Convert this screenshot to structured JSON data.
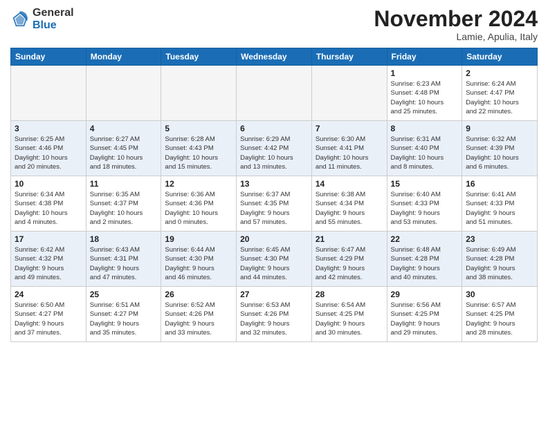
{
  "header": {
    "logo_general": "General",
    "logo_blue": "Blue",
    "month_title": "November 2024",
    "location": "Lamie, Apulia, Italy"
  },
  "columns": [
    "Sunday",
    "Monday",
    "Tuesday",
    "Wednesday",
    "Thursday",
    "Friday",
    "Saturday"
  ],
  "weeks": [
    [
      {
        "day": "",
        "info": ""
      },
      {
        "day": "",
        "info": ""
      },
      {
        "day": "",
        "info": ""
      },
      {
        "day": "",
        "info": ""
      },
      {
        "day": "",
        "info": ""
      },
      {
        "day": "1",
        "info": "Sunrise: 6:23 AM\nSunset: 4:48 PM\nDaylight: 10 hours\nand 25 minutes."
      },
      {
        "day": "2",
        "info": "Sunrise: 6:24 AM\nSunset: 4:47 PM\nDaylight: 10 hours\nand 22 minutes."
      }
    ],
    [
      {
        "day": "3",
        "info": "Sunrise: 6:25 AM\nSunset: 4:46 PM\nDaylight: 10 hours\nand 20 minutes."
      },
      {
        "day": "4",
        "info": "Sunrise: 6:27 AM\nSunset: 4:45 PM\nDaylight: 10 hours\nand 18 minutes."
      },
      {
        "day": "5",
        "info": "Sunrise: 6:28 AM\nSunset: 4:43 PM\nDaylight: 10 hours\nand 15 minutes."
      },
      {
        "day": "6",
        "info": "Sunrise: 6:29 AM\nSunset: 4:42 PM\nDaylight: 10 hours\nand 13 minutes."
      },
      {
        "day": "7",
        "info": "Sunrise: 6:30 AM\nSunset: 4:41 PM\nDaylight: 10 hours\nand 11 minutes."
      },
      {
        "day": "8",
        "info": "Sunrise: 6:31 AM\nSunset: 4:40 PM\nDaylight: 10 hours\nand 8 minutes."
      },
      {
        "day": "9",
        "info": "Sunrise: 6:32 AM\nSunset: 4:39 PM\nDaylight: 10 hours\nand 6 minutes."
      }
    ],
    [
      {
        "day": "10",
        "info": "Sunrise: 6:34 AM\nSunset: 4:38 PM\nDaylight: 10 hours\nand 4 minutes."
      },
      {
        "day": "11",
        "info": "Sunrise: 6:35 AM\nSunset: 4:37 PM\nDaylight: 10 hours\nand 2 minutes."
      },
      {
        "day": "12",
        "info": "Sunrise: 6:36 AM\nSunset: 4:36 PM\nDaylight: 10 hours\nand 0 minutes."
      },
      {
        "day": "13",
        "info": "Sunrise: 6:37 AM\nSunset: 4:35 PM\nDaylight: 9 hours\nand 57 minutes."
      },
      {
        "day": "14",
        "info": "Sunrise: 6:38 AM\nSunset: 4:34 PM\nDaylight: 9 hours\nand 55 minutes."
      },
      {
        "day": "15",
        "info": "Sunrise: 6:40 AM\nSunset: 4:33 PM\nDaylight: 9 hours\nand 53 minutes."
      },
      {
        "day": "16",
        "info": "Sunrise: 6:41 AM\nSunset: 4:33 PM\nDaylight: 9 hours\nand 51 minutes."
      }
    ],
    [
      {
        "day": "17",
        "info": "Sunrise: 6:42 AM\nSunset: 4:32 PM\nDaylight: 9 hours\nand 49 minutes."
      },
      {
        "day": "18",
        "info": "Sunrise: 6:43 AM\nSunset: 4:31 PM\nDaylight: 9 hours\nand 47 minutes."
      },
      {
        "day": "19",
        "info": "Sunrise: 6:44 AM\nSunset: 4:30 PM\nDaylight: 9 hours\nand 46 minutes."
      },
      {
        "day": "20",
        "info": "Sunrise: 6:45 AM\nSunset: 4:30 PM\nDaylight: 9 hours\nand 44 minutes."
      },
      {
        "day": "21",
        "info": "Sunrise: 6:47 AM\nSunset: 4:29 PM\nDaylight: 9 hours\nand 42 minutes."
      },
      {
        "day": "22",
        "info": "Sunrise: 6:48 AM\nSunset: 4:28 PM\nDaylight: 9 hours\nand 40 minutes."
      },
      {
        "day": "23",
        "info": "Sunrise: 6:49 AM\nSunset: 4:28 PM\nDaylight: 9 hours\nand 38 minutes."
      }
    ],
    [
      {
        "day": "24",
        "info": "Sunrise: 6:50 AM\nSunset: 4:27 PM\nDaylight: 9 hours\nand 37 minutes."
      },
      {
        "day": "25",
        "info": "Sunrise: 6:51 AM\nSunset: 4:27 PM\nDaylight: 9 hours\nand 35 minutes."
      },
      {
        "day": "26",
        "info": "Sunrise: 6:52 AM\nSunset: 4:26 PM\nDaylight: 9 hours\nand 33 minutes."
      },
      {
        "day": "27",
        "info": "Sunrise: 6:53 AM\nSunset: 4:26 PM\nDaylight: 9 hours\nand 32 minutes."
      },
      {
        "day": "28",
        "info": "Sunrise: 6:54 AM\nSunset: 4:25 PM\nDaylight: 9 hours\nand 30 minutes."
      },
      {
        "day": "29",
        "info": "Sunrise: 6:56 AM\nSunset: 4:25 PM\nDaylight: 9 hours\nand 29 minutes."
      },
      {
        "day": "30",
        "info": "Sunrise: 6:57 AM\nSunset: 4:25 PM\nDaylight: 9 hours\nand 28 minutes."
      }
    ]
  ]
}
